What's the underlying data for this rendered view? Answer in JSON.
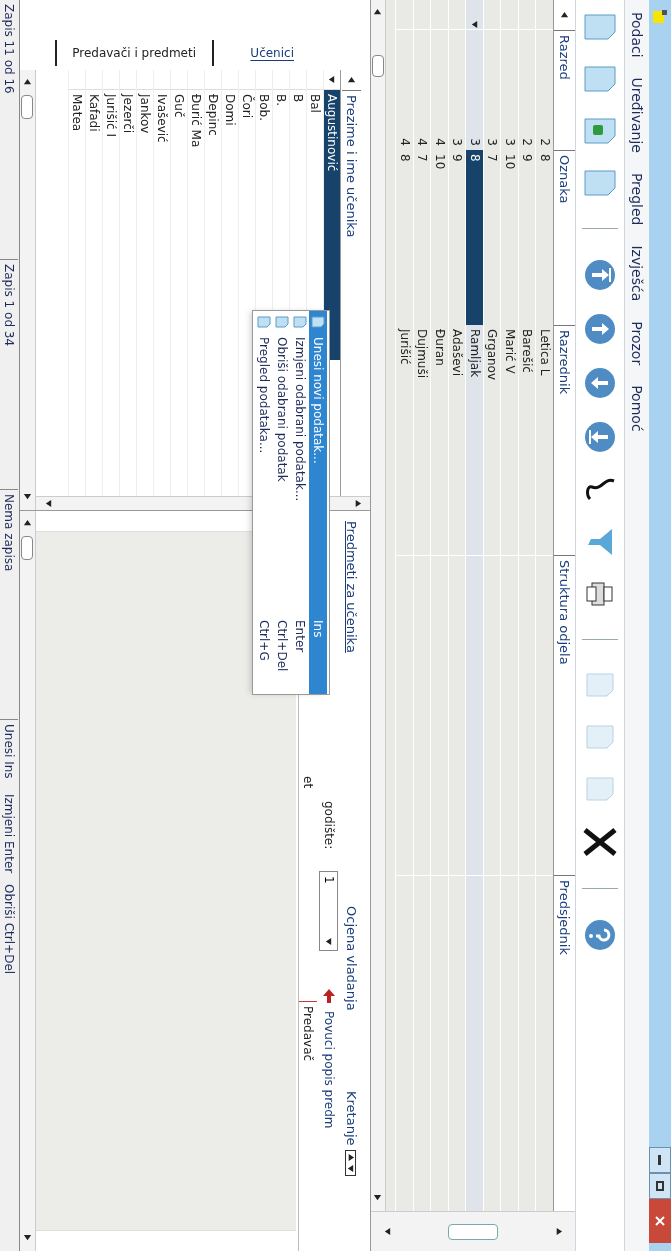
{
  "menu": [
    "Podaci",
    "Uređivanje",
    "Pregled",
    "Izvješća",
    "Prozor",
    "Pomoć"
  ],
  "grid": {
    "columns": [
      "Razred",
      "Oznaka",
      "Razrednik",
      "Struktura odjela",
      "Predsjednik"
    ],
    "rows": [
      {
        "razred": "2",
        "oznaka": "8",
        "razrednik": "Letica L",
        "selected": false
      },
      {
        "razred": "2",
        "oznaka": "9",
        "razrednik": "Barešić",
        "selected": false
      },
      {
        "razred": "3",
        "oznaka": "10",
        "razrednik": "Marić V",
        "selected": false
      },
      {
        "razred": "3",
        "oznaka": "7",
        "razrednik": "Grganov",
        "selected": false
      },
      {
        "razred": "3",
        "oznaka": "8",
        "razrednik": "Ramljak",
        "selected": true
      },
      {
        "razred": "3",
        "oznaka": "9",
        "razrednik": "Adaševi",
        "selected": false
      },
      {
        "razred": "4",
        "oznaka": "10",
        "razrednik": "Đuran",
        "selected": false
      },
      {
        "razred": "4",
        "oznaka": "7",
        "razrednik": "Dujmuši",
        "selected": false
      },
      {
        "razred": "4",
        "oznaka": "8",
        "razrednik": "Jurišić",
        "selected": false
      }
    ]
  },
  "tabs": [
    {
      "label": "Predavači i predmeti",
      "selected": false
    },
    {
      "label": "Učenici",
      "selected": true
    }
  ],
  "students": {
    "column": "Prezime i ime učenika",
    "rows": [
      {
        "name": "Augustinović",
        "selected": true
      },
      {
        "name": "Bal",
        "selected": false
      },
      {
        "name": "B",
        "selected": false
      },
      {
        "name": "B.",
        "selected": false
      },
      {
        "name": "Bob.",
        "selected": false
      },
      {
        "name": "Čori",
        "selected": false
      },
      {
        "name": "Domi",
        "selected": false
      },
      {
        "name": "Đepinc",
        "selected": false
      },
      {
        "name": "Đurić Ma",
        "selected": false
      },
      {
        "name": "Guč",
        "selected": false
      },
      {
        "name": "Ivašević",
        "selected": false
      },
      {
        "name": "Jankov",
        "selected": false
      },
      {
        "name": "Jezerči",
        "selected": false
      },
      {
        "name": "Jurišić I",
        "selected": false
      },
      {
        "name": "Kafadi",
        "selected": false
      },
      {
        "name": "Matea",
        "selected": false
      }
    ]
  },
  "subjects": {
    "title": "Predmeti za učenika",
    "conduct_label": "Ocjena vladanja",
    "movement_label": "Kretanje",
    "year_label": "godište:",
    "year_value": "1",
    "pull_link": "Povuci popis predm",
    "columns": [
      "et",
      "Predavač"
    ]
  },
  "context_menu": [
    {
      "label": "Unesi novi podatak...",
      "shortcut": "Ins",
      "selected": true
    },
    {
      "label": "Izmjeni odabrani podatak...",
      "shortcut": "Enter",
      "selected": false
    },
    {
      "label": "Obriši odabrani podatak",
      "shortcut": "Ctrl+Del",
      "selected": false
    },
    {
      "label": "Pregled podataka...",
      "shortcut": "Ctrl+G",
      "selected": false
    }
  ],
  "status_bar": [
    "Zapis 11 od 16",
    "Zapis 1 od 34",
    "Nema zapisa",
    "Unesi Ins",
    "Izmjeni Enter",
    "Obriši Ctrl+Del"
  ]
}
